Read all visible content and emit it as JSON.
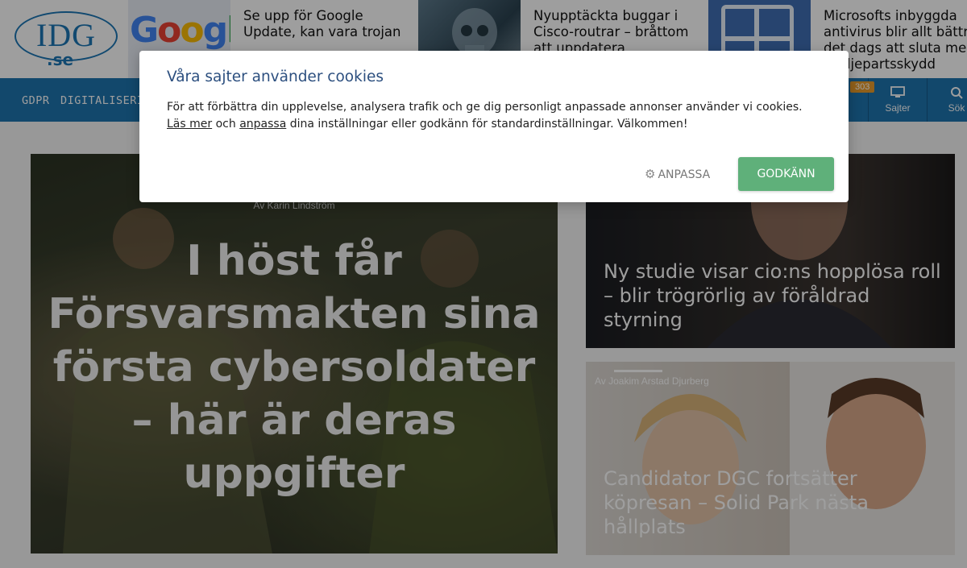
{
  "logo": {
    "text": "IDG",
    "sub": ".se"
  },
  "teasers": [
    {
      "title": "Se upp för Google Update, kan vara trojan",
      "thumb_text": "Google"
    },
    {
      "title": "Nyupptäckta buggar i Cisco-routrar – bråttom att uppdatera"
    },
    {
      "title": "Microsofts inbyggda antivirus blir allt bättre Är det dags att sluta med tredjepartsskydd"
    }
  ],
  "nav": {
    "items": [
      "GDPR",
      "DIGITALISERING"
    ],
    "badge": "303",
    "right": [
      {
        "label": "Sajter",
        "icon": "monitor-icon"
      },
      {
        "label": "Sök",
        "icon": "search-icon"
      }
    ],
    "color": "#1e74ae"
  },
  "main_feature": {
    "author": "Av Karin Lindström",
    "headline": "I höst får Försvarsmakten sina första cybersoldater – här är deras uppgifter"
  },
  "side_articles": [
    {
      "headline": "Ny studie visar cio:ns hopplösa roll – blir trögrörlig av föråldrad styrning"
    },
    {
      "author": "Av Joakim Arstad Djurberg",
      "headline": "Candidator DGC fortsätter köpresan – Solid Park nästa hållplats"
    }
  ],
  "cookie_modal": {
    "title": "Våra sajter använder cookies",
    "text_1": "För att förbättra din upplevelse, analysera trafik och ge dig personligt anpassade annonser använder vi cookies.",
    "link_read_more": "Läs mer",
    "text_and": " och ",
    "link_customize": "anpassa",
    "text_2": " dina inställningar eller godkänn för standardinställningar. Välkommen!",
    "customize_button": "ANPASSA",
    "accept_button": "GODKÄNN",
    "accept_color": "#5fb07a",
    "title_color": "#2c4f7f"
  }
}
